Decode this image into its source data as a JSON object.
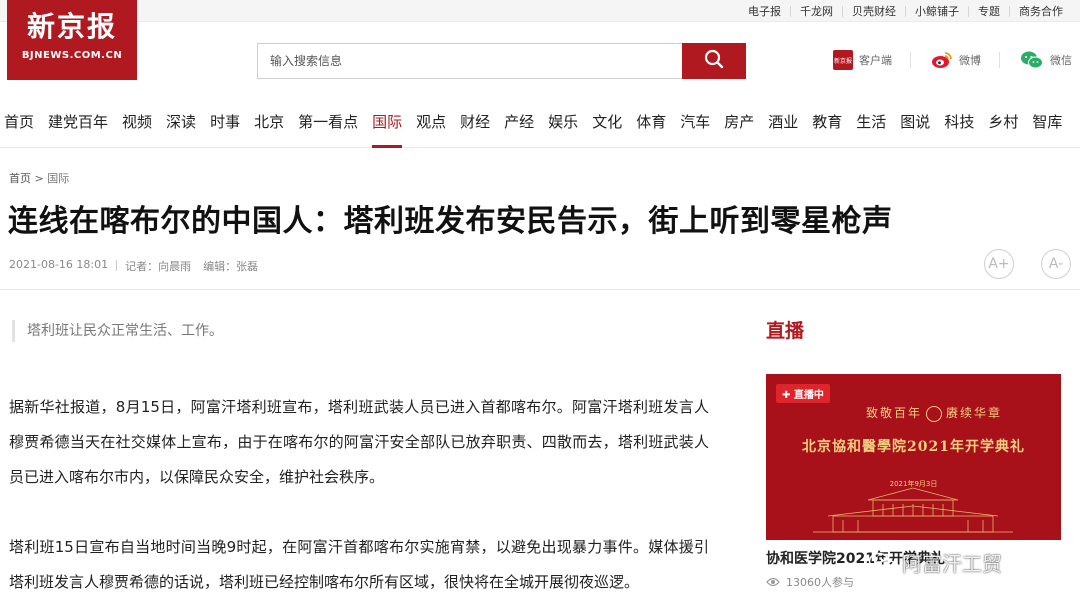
{
  "site": {
    "logo_cn": "新京报",
    "logo_en": "BJNEWS.COM.CN"
  },
  "toplinks": [
    "电子报",
    "千龙网",
    "贝壳财经",
    "小鲸铺子",
    "专题",
    "商务合作"
  ],
  "search": {
    "placeholder": "输入搜索信息",
    "value": ""
  },
  "social": {
    "client_label": "客户端",
    "client_icon_text": "新京报",
    "weibo_label": "微博",
    "wechat_label": "微信"
  },
  "nav": [
    "首页",
    "建党百年",
    "视频",
    "深读",
    "时事",
    "北京",
    "第一看点",
    "国际",
    "观点",
    "财经",
    "产经",
    "娱乐",
    "文化",
    "体育",
    "汽车",
    "房产",
    "酒业",
    "教育",
    "生活",
    "图说",
    "科技",
    "乡村",
    "智库"
  ],
  "nav_active": "国际",
  "breadcrumb": {
    "home": "首页",
    "sep": ">",
    "current": "国际"
  },
  "article": {
    "title": "连线在喀布尔的中国人：塔利班发布安民告示，街上听到零星枪声",
    "date": "2021-08-16 18:01",
    "reporter": "记者：向晨雨",
    "editor": "编辑：张磊",
    "summary": "塔利班让民众正常生活、工作。",
    "paragraphs": [
      "据新华社报道，8月15日，阿富汗塔利班宣布，塔利班武装人员已进入首都喀布尔。阿富汗塔利班发言人穆贾希德当天在社交媒体上宣布，由于在喀布尔的阿富汗安全部队已放弃职责、四散而去，塔利班武装人员已进入喀布尔市内，以保障民众安全，维护社会秩序。",
      "塔利班15日宣布自当地时间当晚9时起，在阿富汗首都喀布尔实施宵禁，以避免出现暴力事件。媒体援引塔利班发言人穆贾希德的话说，塔利班已经控制喀布尔所有区域，很快将在全城开展彻夜巡逻。"
    ]
  },
  "font_buttons": [
    "A+",
    "A-"
  ],
  "sidebar": {
    "live_heading": "直播",
    "live_card": {
      "badge": "直播中",
      "line1_left": "致敬百年",
      "line1_right": "赓续华章",
      "line2": "北京協和醫學院2021年开学典礼",
      "date": "2021年9月3日",
      "title": "协和医学院2021年开学典礼",
      "views": "13060人参与"
    }
  },
  "watermark": "阿富汗工贸",
  "colors": {
    "brand_red": "#b0191f",
    "gold": "#f3cf82",
    "live_bg": "#a8101a"
  }
}
